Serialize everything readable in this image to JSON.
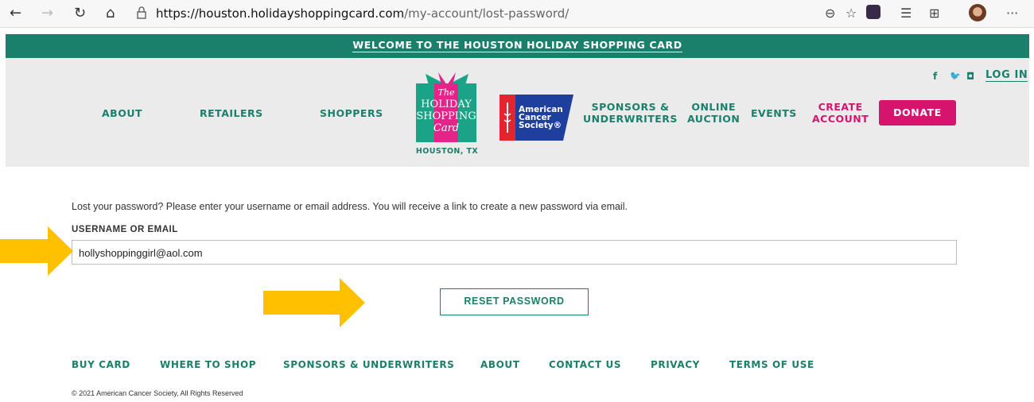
{
  "browser": {
    "url_host": "https://houston.holidayshoppingcard.com",
    "url_path": "/my-account/lost-password/",
    "icons": [
      "back-icon",
      "forward-icon",
      "refresh-icon",
      "home-icon",
      "lock-icon",
      "zoom-icon",
      "favorite-star-icon",
      "extension-icon",
      "favorites-list-icon",
      "collections-icon",
      "profile-avatar",
      "more-icon"
    ]
  },
  "welcome_bar": {
    "text": "WELCOME TO THE HOUSTON HOLIDAY SHOPPING CARD"
  },
  "header": {
    "nav": {
      "about": "ABOUT",
      "retailers": "RETAILERS",
      "shoppers": "SHOPPERS",
      "sponsors_line1": "SPONSORS &",
      "sponsors_line2": "UNDERWRITERS",
      "online_line1": "ONLINE",
      "online_line2": "AUCTION",
      "events": "EVENTS",
      "create_line1": "CREATE",
      "create_line2": "ACCOUNT"
    },
    "donate_label": "DONATE",
    "login_label": "LOG IN",
    "social": {
      "facebook": "f",
      "twitter": "🐦",
      "instagram": "◘"
    },
    "logo": {
      "line1": "The",
      "line2": "HOLIDAY",
      "line3": "SHOPPING",
      "line4": "Card",
      "city": "HOUSTON, TX"
    },
    "acs_logo": {
      "line1": "American",
      "line2": "Cancer",
      "line3": "Society®"
    }
  },
  "main": {
    "instructions": "Lost your password? Please enter your username or email address. You will receive a link to create a new password via email.",
    "field_label": "USERNAME OR EMAIL",
    "field_value": "hollyshoppinggirl@aol.com",
    "reset_label": "RESET PASSWORD"
  },
  "footer": {
    "links": [
      "BUY CARD",
      "WHERE TO SHOP",
      "SPONSORS & UNDERWRITERS",
      "ABOUT",
      "CONTACT US",
      "PRIVACY",
      "TERMS OF USE"
    ],
    "copyright": "© 2021 American Cancer Society, All Rights Reserved"
  },
  "colors": {
    "teal": "#1a7f6b",
    "pink": "#d6146e",
    "arrow": "#ffc000",
    "header_bg": "#ebebeb"
  }
}
